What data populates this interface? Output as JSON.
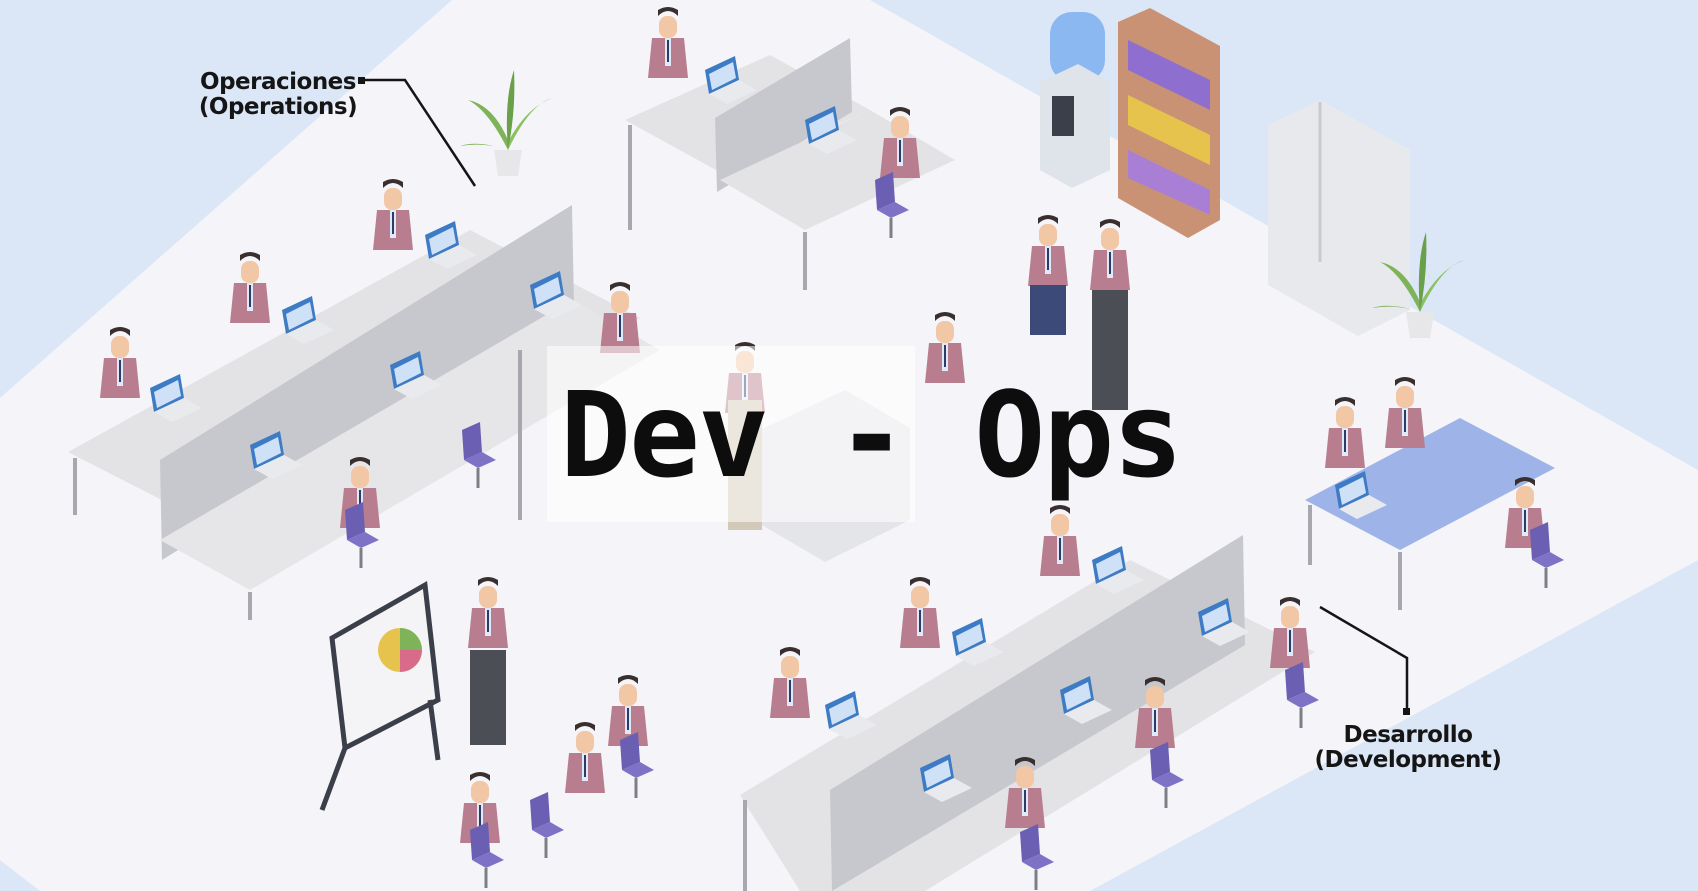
{
  "title": "Dev - Ops",
  "labels": {
    "operations": {
      "line1": "Operaciones",
      "line2": "(Operations)"
    },
    "development": {
      "line1": "Desarrollo",
      "line2": "(Development)"
    }
  },
  "colors": {
    "background": "#dbe7f7",
    "floor": "#f5f5f9",
    "desk": "#e3e3e6",
    "partition": "#c7c8cd",
    "jacket": "#b87d8e",
    "shirt": "#dfeaf6",
    "chair": "#6a5fb3",
    "screen": "#3d7bc4",
    "plant": "#7fb35a",
    "shelf": "#c99274",
    "meeting_table": "#8ea8e6"
  }
}
